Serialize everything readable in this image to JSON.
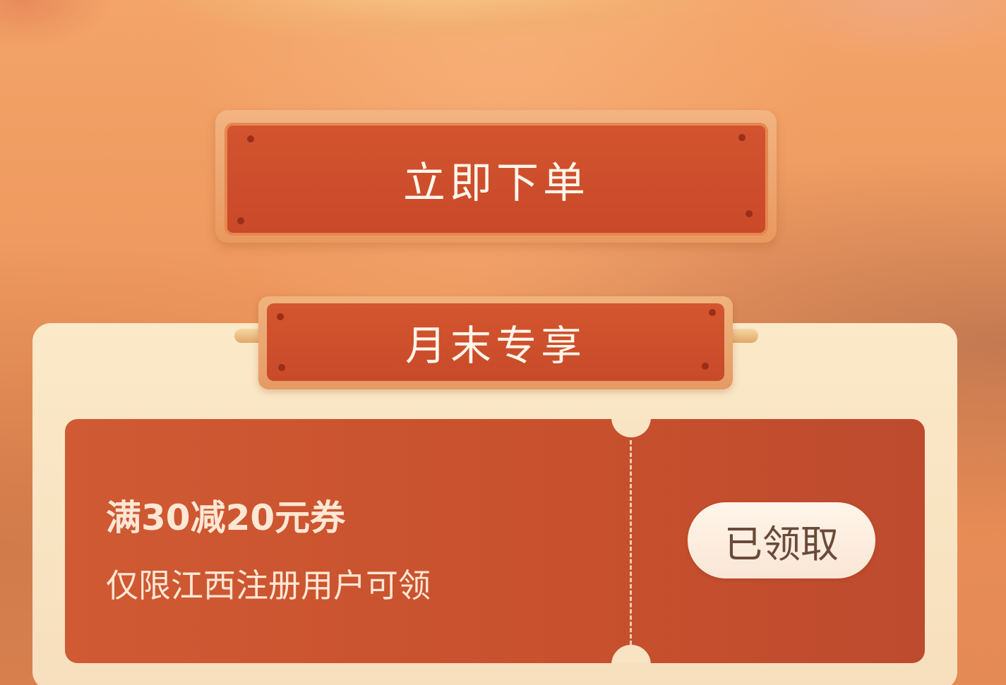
{
  "order_button": {
    "label": "立即下单"
  },
  "banner": {
    "title": "月末专享"
  },
  "coupon": {
    "title": "满30减20元券",
    "description": "仅限江西注册用户可领",
    "status_button": "已领取"
  },
  "colors": {
    "background": "#ef9a60",
    "button_red": "#cd4f2c",
    "card": "#fbe9c8",
    "coupon": "#c8502d",
    "text_light": "#fff5ea"
  }
}
